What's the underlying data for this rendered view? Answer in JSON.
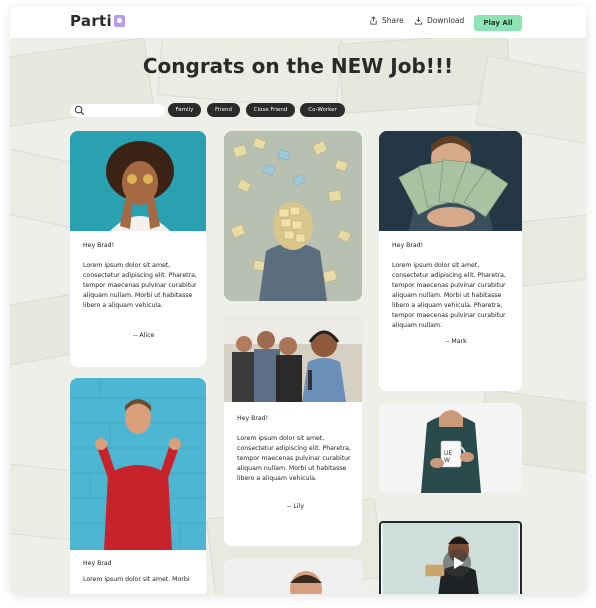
{
  "app": {
    "name": "Parti"
  },
  "header": {
    "share_label": "Share",
    "download_label": "Download",
    "play_all_label": "Play All"
  },
  "page": {
    "title": "Congrats on the NEW Job!!!"
  },
  "search": {
    "placeholder": ""
  },
  "filters": [
    "Family",
    "Friend",
    "Close Friend",
    "Co-Worker"
  ],
  "colors": {
    "play_all": "#8de3b6",
    "chip": "#2b2b2b",
    "logo_accent": "#b79ce8"
  },
  "cards": {
    "alice": {
      "greeting": "Hey Brad!",
      "body": "Lorem ipsum dolor sit amet, consectetur adipiscing elit. Pharetra, tempor maecenas pulvinar curabitur aliquam nullam. Morbi ut habitasse libero a aliquam vehicula.",
      "signature": "-- Alice"
    },
    "lily": {
      "greeting": "Hey Brad!",
      "body": "Lorem ipsum dolor sit amet, consectetur adipiscing elit. Pharetra, tempor maecenas pulvinar curabitur aliquam nullam. Morbi ut habitasse libero a aliquam vehicula.",
      "signature": "-- Lily"
    },
    "mark": {
      "greeting": "Hey Brad!",
      "body": "Lorem ipsum dolor sit amet, consectetur adipiscing elit. Pharetra, tempor maecenas pulvinar curabitur aliquam nullam. Morbi ut habitasse libero a aliquam vehicula. Pharetra, tempor maecenas pulvinar curabitur aliquam nullam.",
      "signature": "-- Mark"
    },
    "fourth": {
      "greeting": "Hey Brad",
      "body": "Lorem ipsum dolor sit amet. Morbi"
    }
  },
  "icons": {
    "share": "share-icon",
    "download": "download-icon",
    "search": "search-icon",
    "play": "play-icon"
  }
}
